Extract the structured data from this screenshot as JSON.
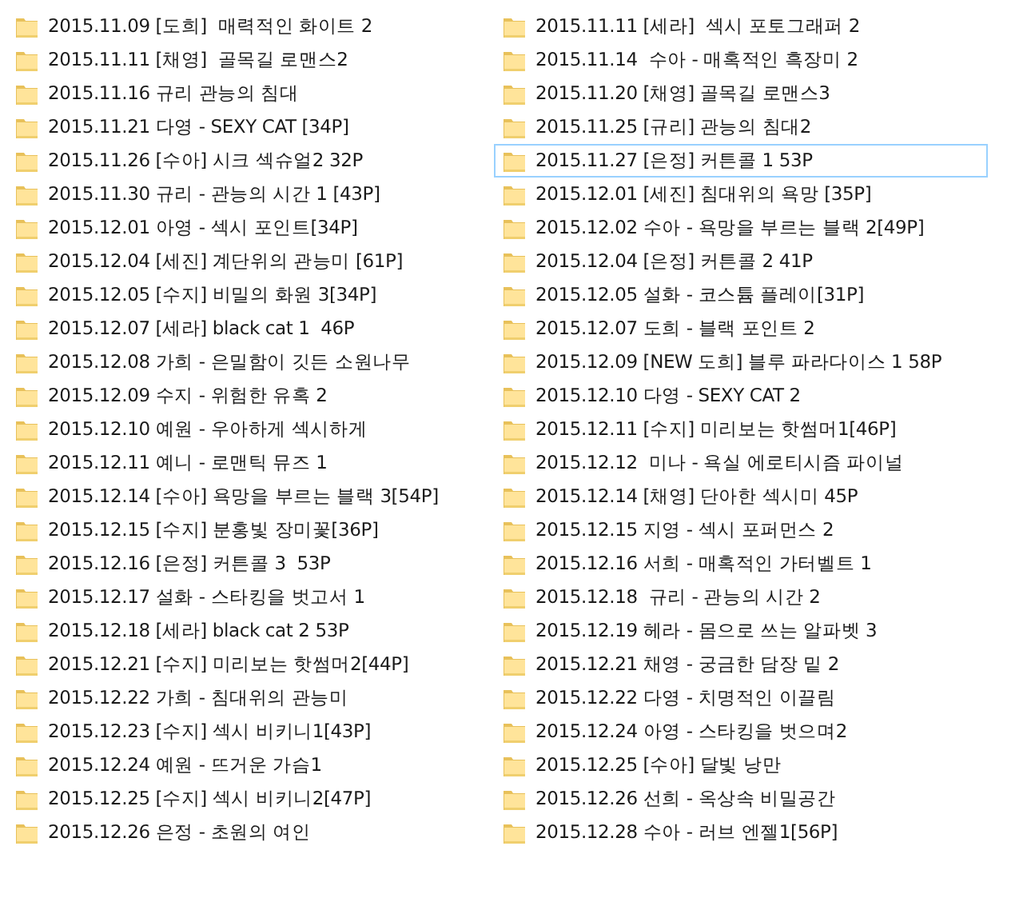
{
  "columns": [
    {
      "items": [
        {
          "name": "2015.11.09 [도희]  매력적인 화이트 2",
          "focused": false
        },
        {
          "name": "2015.11.11 [채영]  골목길 로맨스2",
          "focused": false
        },
        {
          "name": "2015.11.16 규리 관능의 침대",
          "focused": false
        },
        {
          "name": "2015.11.21 다영 - SEXY CAT [34P]",
          "focused": false
        },
        {
          "name": "2015.11.26 [수아] 시크 섹슈얼2 32P",
          "focused": false
        },
        {
          "name": "2015.11.30 규리 - 관능의 시간 1 [43P]",
          "focused": false
        },
        {
          "name": "2015.12.01 아영 - 섹시 포인트[34P]",
          "focused": false
        },
        {
          "name": "2015.12.04 [세진] 계단위의 관능미 [61P]",
          "focused": false
        },
        {
          "name": "2015.12.05 [수지] 비밀의 화원 3[34P]",
          "focused": false
        },
        {
          "name": "2015.12.07 [세라] black cat 1  46P",
          "focused": false
        },
        {
          "name": "2015.12.08 가희 - 은밀함이 깃든 소원나무",
          "focused": false
        },
        {
          "name": "2015.12.09 수지 - 위험한 유혹 2",
          "focused": false
        },
        {
          "name": "2015.12.10 예원 - 우아하게 섹시하게",
          "focused": false
        },
        {
          "name": "2015.12.11 예니 - 로맨틱 뮤즈 1",
          "focused": false
        },
        {
          "name": "2015.12.14 [수아] 욕망을 부르는 블랙 3[54P]",
          "focused": false
        },
        {
          "name": "2015.12.15 [수지] 분홍빛 장미꽃[36P]",
          "focused": false
        },
        {
          "name": "2015.12.16 [은정] 커튼콜 3  53P",
          "focused": false
        },
        {
          "name": "2015.12.17 설화 - 스타킹을 벗고서 1",
          "focused": false
        },
        {
          "name": "2015.12.18 [세라] black cat 2 53P",
          "focused": false
        },
        {
          "name": "2015.12.21 [수지] 미리보는 핫썸머2[44P]",
          "focused": false
        },
        {
          "name": "2015.12.22 가희 - 침대위의 관능미",
          "focused": false
        },
        {
          "name": "2015.12.23 [수지] 섹시 비키니1[43P]",
          "focused": false
        },
        {
          "name": "2015.12.24 예원 - 뜨거운 가슴1",
          "focused": false
        },
        {
          "name": "2015.12.25 [수지] 섹시 비키니2[47P]",
          "focused": false
        },
        {
          "name": "2015.12.26 은정 - 초원의 여인",
          "focused": false
        }
      ]
    },
    {
      "items": [
        {
          "name": "2015.11.11 [세라]  섹시 포토그래퍼 2",
          "focused": false
        },
        {
          "name": "2015.11.14  수아 - 매혹적인 흑장미 2",
          "focused": false
        },
        {
          "name": "2015.11.20 [채영] 골목길 로맨스3",
          "focused": false
        },
        {
          "name": "2015.11.25 [규리] 관능의 침대2",
          "focused": false
        },
        {
          "name": "2015.11.27 [은정] 커튼콜 1 53P",
          "focused": true
        },
        {
          "name": "2015.12.01 [세진] 침대위의 욕망 [35P]",
          "focused": false
        },
        {
          "name": "2015.12.02 수아 - 욕망을 부르는 블랙 2[49P]",
          "focused": false
        },
        {
          "name": "2015.12.04 [은정] 커튼콜 2 41P",
          "focused": false
        },
        {
          "name": "2015.12.05 설화 - 코스튬 플레이[31P]",
          "focused": false
        },
        {
          "name": "2015.12.07 도희 - 블랙 포인트 2",
          "focused": false
        },
        {
          "name": "2015.12.09 [NEW 도희] 블루 파라다이스 1 58P",
          "focused": false
        },
        {
          "name": "2015.12.10 다영 - SEXY CAT 2",
          "focused": false
        },
        {
          "name": "2015.12.11 [수지] 미리보는 핫썸머1[46P]",
          "focused": false
        },
        {
          "name": "2015.12.12  미나 - 욕실 에로티시즘 파이널",
          "focused": false
        },
        {
          "name": "2015.12.14 [채영] 단아한 섹시미 45P",
          "focused": false
        },
        {
          "name": "2015.12.15 지영 - 섹시 포퍼먼스 2",
          "focused": false
        },
        {
          "name": "2015.12.16 서희 - 매혹적인 가터벨트 1",
          "focused": false
        },
        {
          "name": "2015.12.18  규리 - 관능의 시간 2",
          "focused": false
        },
        {
          "name": "2015.12.19 헤라 - 몸으로 쓰는 알파벳 3",
          "focused": false
        },
        {
          "name": "2015.12.21 채영 - 궁금한 담장 밑 2",
          "focused": false
        },
        {
          "name": "2015.12.22 다영 - 치명적인 이끌림",
          "focused": false
        },
        {
          "name": "2015.12.24 아영 - 스타킹을 벗으며2",
          "focused": false
        },
        {
          "name": "2015.12.25 [수아] 달빛 낭만",
          "focused": false
        },
        {
          "name": "2015.12.26 선희 - 옥상속 비밀공간",
          "focused": false
        },
        {
          "name": "2015.12.28 수아 - 러브 엔젤1[56P]",
          "focused": false
        }
      ]
    }
  ]
}
